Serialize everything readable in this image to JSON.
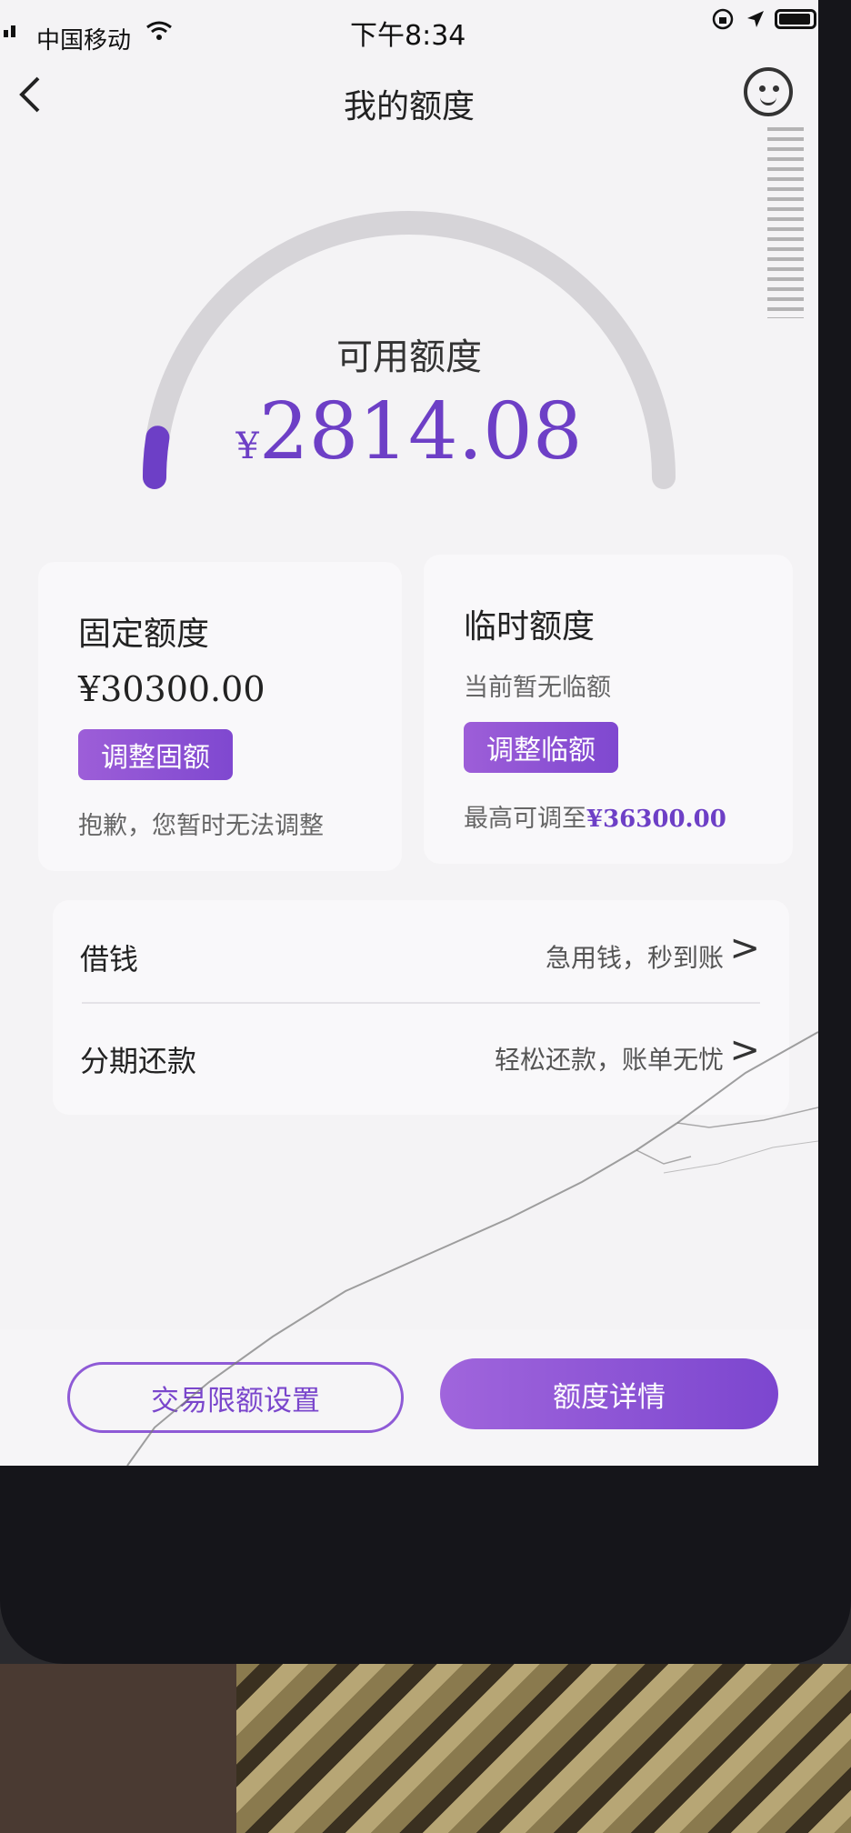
{
  "status_bar": {
    "carrier": "中国移动",
    "time": "下午8:34",
    "icons": [
      "signal-icon",
      "wifi-icon",
      "rotation-lock-icon",
      "location-icon",
      "battery-icon"
    ]
  },
  "nav": {
    "back_glyph": "<",
    "title": "我的额度",
    "service_icon": "customer-service-icon"
  },
  "gauge": {
    "label": "可用额度",
    "currency": "¥",
    "amount": "2814.08",
    "fill_fraction": 0.1,
    "track_color": "#d6d4d8",
    "fill_color": "#6d3fc6"
  },
  "fixed_quota": {
    "title": "固定额度",
    "value": "¥30300.00",
    "button": "调整固额",
    "note": "抱歉，您暂时无法调整"
  },
  "temp_quota": {
    "title": "临时额度",
    "status": "当前暂无临额",
    "button": "调整临额",
    "note_prefix": "最高可调至",
    "note_value": "¥36300.00"
  },
  "menu": [
    {
      "label": "借钱",
      "desc": "急用钱，秒到账",
      "chevron": ">"
    },
    {
      "label": "分期还款",
      "desc": "轻松还款，账单无忧",
      "chevron": ">"
    }
  ],
  "bottom": {
    "limit_settings": "交易限额设置",
    "quota_details": "额度详情"
  },
  "colors": {
    "accent": "#6d3fc6",
    "button_gradient_start": "#9d5ed8",
    "button_gradient_end": "#7f48d0",
    "background": "#f4f3f5"
  }
}
